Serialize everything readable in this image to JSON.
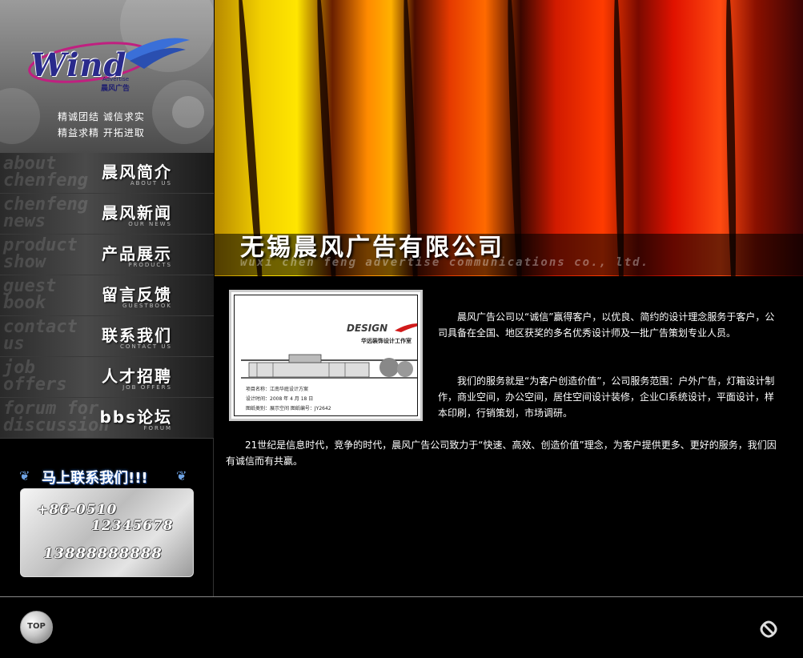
{
  "logo": {
    "word": "Wind",
    "sub_en": "Advertise",
    "sub_cn": "晨风广告"
  },
  "slogan": {
    "line1": "精诚团结  诚信求实",
    "line2": "精益求精  开拓进取"
  },
  "nav": {
    "items": [
      {
        "cn": "晨风简介",
        "en": "ABOUT US",
        "ghost": "about\nchenfeng"
      },
      {
        "cn": "晨风新闻",
        "en": "OUR NEWS",
        "ghost": "chenfeng\nnews"
      },
      {
        "cn": "产品展示",
        "en": "PRODUCTS",
        "ghost": "product\nshow"
      },
      {
        "cn": "留言反馈",
        "en": "GUESTBOOK",
        "ghost": "guest\nbook"
      },
      {
        "cn": "联系我们",
        "en": "CONTACT US",
        "ghost": "contact\nus"
      },
      {
        "cn": "人才招聘",
        "en": "JOB OFFERS",
        "ghost": "job\noffers"
      },
      {
        "cn": "bbs论坛",
        "en": "FORUM",
        "ghost": "forum for\ndiscussion"
      }
    ]
  },
  "contact": {
    "title": "马上联系我们!!!",
    "phone_area": "+86-0510",
    "phone_number": "12345678",
    "mobile": "13888888888"
  },
  "hero": {
    "company_name": "无锡晨风广告有限公司",
    "company_en": "wuxi chen feng advertise communications co., ltd."
  },
  "photo": {
    "design": "DESIGN",
    "studio": "华远装饰设计工作室",
    "line1": "项目名称：江南华庭设计方案",
    "line2": "设计时间：2008 年 4 月 18 日",
    "line3": "图纸类别：展示空间        图纸编号：JY2642"
  },
  "content": {
    "para1": "晨风广告公司以“诚信”赢得客户，以优良、简约的设计理念服务于客户，公司具备在全国、地区获奖的多名优秀设计师及一批广告策划专业人员。",
    "para2": "我们的服务就是“为客户创造价值”，公司服务范围：户外广告，灯箱设计制作，商业空间，办公空间，居住空间设计装修，企业CI系统设计，平面设计，样本印刷，行销策划，市场调研。",
    "para3": "21世纪是信息时代，竞争的时代，晨风广告公司致力于“快速、高效、创造价值”理念，为客户提供更多、更好的服务，我们因有诚信而有共赢。"
  },
  "footer": {
    "top_label": "TOP"
  },
  "colors": {
    "background": "#000000",
    "sidebar_gray": "#6f6f6f",
    "hero_red": "#e01200",
    "hero_yellow": "#ffe600",
    "contact_blue": "#6fa4e6"
  }
}
